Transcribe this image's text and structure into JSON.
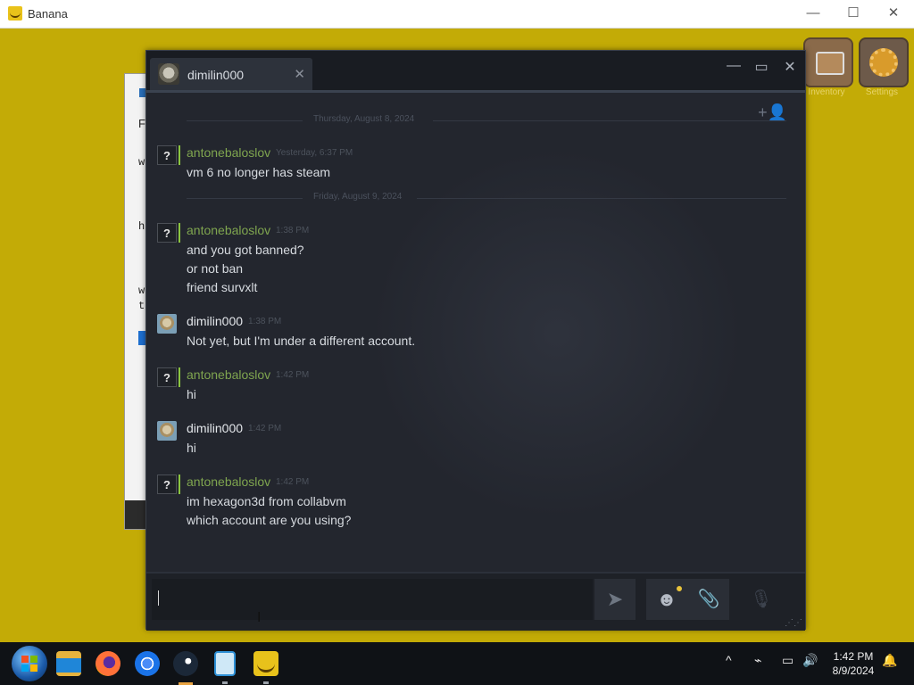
{
  "outer_window": {
    "title": "Banana",
    "controls": {
      "minimize": "—",
      "maximize": "☐",
      "close": "✕"
    }
  },
  "background_window": {
    "text_lines": [
      "Fi",
      "w",
      "h",
      "w",
      "t"
    ]
  },
  "desktop_icons": [
    {
      "label": "Inventory",
      "icon": "treasure-chest-icon"
    },
    {
      "label": "Settings",
      "icon": "gear-icon"
    }
  ],
  "chat": {
    "tab": {
      "name": "dimilin000",
      "close": "✕"
    },
    "window_controls": {
      "minimize": "—",
      "maximize": "▭",
      "close": "✕"
    },
    "add_friend_icon": "+👤",
    "day_dividers": [
      "Thursday, August 8, 2024",
      "Friday, August 9, 2024"
    ],
    "messages": [
      {
        "sender": "antonebaloslov",
        "role": "friend",
        "time": "Yesterday, 6:37 PM",
        "lines": [
          "vm 6 no longer has steam"
        ]
      },
      {
        "sender": "antonebaloslov",
        "role": "friend",
        "time": "1:38 PM",
        "lines": [
          "and you got banned?",
          "or not ban",
          "friend survxlt"
        ]
      },
      {
        "sender": "dimilin000",
        "role": "me",
        "time": "1:38 PM",
        "lines": [
          "Not yet, but I'm under a different account."
        ]
      },
      {
        "sender": "antonebaloslov",
        "role": "friend",
        "time": "1:42 PM",
        "lines": [
          "hi"
        ]
      },
      {
        "sender": "dimilin000",
        "role": "me",
        "time": "1:42 PM",
        "lines": [
          "hi"
        ]
      },
      {
        "sender": "antonebaloslov",
        "role": "friend",
        "time": "1:42 PM",
        "lines": [
          "im hexagon3d from collabvm",
          "which account are you using?"
        ]
      }
    ],
    "input": {
      "value": ""
    },
    "buttons": {
      "send": "➤",
      "emoticon": "☻",
      "attach": "📎",
      "voice": "🎙"
    }
  },
  "taskbar": {
    "apps": [
      "start",
      "file-explorer",
      "firefox",
      "chrome",
      "steam",
      "notepad",
      "banana"
    ],
    "tray": {
      "chevron": "^",
      "network": "⌁",
      "display": "▭",
      "volume": "🔊",
      "notifications": "🔔"
    },
    "time": "1:42 PM",
    "date": "8/9/2024"
  },
  "colors": {
    "desktop": "#c3ab06",
    "chat_bg": "#23262e",
    "friend_name": "#7fa54f",
    "online_bar": "#8bc53f"
  }
}
